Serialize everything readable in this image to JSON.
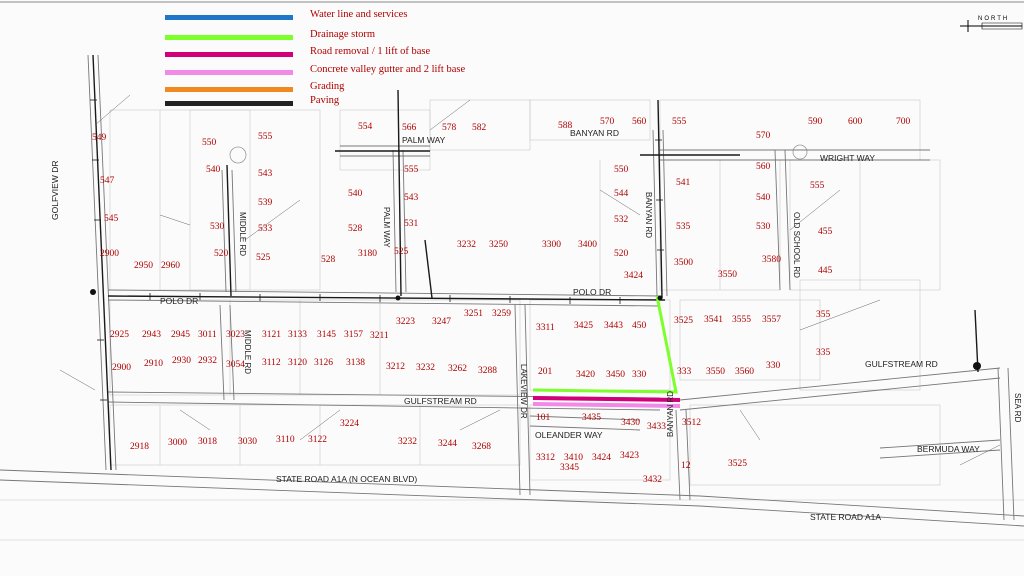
{
  "legend": [
    {
      "label": "Water line and services",
      "color": "#1f77c8"
    },
    {
      "label": "Drainage storm",
      "color": "#7cff2a"
    },
    {
      "label": "Road removal / 1 lift of base",
      "color": "#d1007a"
    },
    {
      "label": "Concrete valley gutter and 2 lift base",
      "color": "#f08ae6"
    },
    {
      "label": "Grading",
      "color": "#f08a1e"
    },
    {
      "label": "Paving",
      "color": "#222222"
    }
  ],
  "north_label": "NORTH",
  "streets": {
    "golfview": "GOLFVIEW DR",
    "palm_way_top": "PALM WAY",
    "palm_way_v": "PALM WAY",
    "middle_top": "MIDDLE RD",
    "middle_bottom": "MIDDLE RD",
    "banyan_top": "BANYAN RD",
    "banyan_v": "BANYAN RD",
    "banyan_bottom": "BANYAN RD",
    "wright": "WRIGHT WAY",
    "old_school": "OLD SCHOOL RD",
    "polo_left": "POLO DR",
    "polo_right": "POLO DR",
    "gulfstream_left": "GULFSTREAM RD",
    "gulfstream_right": "GULFSTREAM RD",
    "lakeview": "LAKEVIEW DR",
    "oleander": "OLEANDER WAY",
    "bermuda": "BERMUDA WAY",
    "sea": "SEA RD",
    "a1a_left": "STATE ROAD A1A (N OCEAN BLVD)",
    "a1a_right": "STATE ROAD A1A"
  },
  "lots": [
    "549",
    "547",
    "545",
    "550",
    "555",
    "540",
    "543",
    "539",
    "530",
    "533",
    "520",
    "525",
    "554",
    "566",
    "578",
    "582",
    "555",
    "540",
    "543",
    "528",
    "531",
    "525",
    "588",
    "570",
    "560",
    "555",
    "550",
    "544",
    "532",
    "520",
    "541",
    "535",
    "570",
    "590",
    "600",
    "700",
    "560",
    "555",
    "540",
    "530",
    "455",
    "445",
    "2900",
    "2950",
    "2960",
    "528",
    "3180",
    "3232",
    "3250",
    "3300",
    "3400",
    "3424",
    "3500",
    "3550",
    "3580",
    "2925",
    "2943",
    "2945",
    "3011",
    "3023",
    "3121",
    "3133",
    "3145",
    "3157",
    "3211",
    "3223",
    "3247",
    "3251",
    "3259",
    "3311",
    "3425",
    "3443",
    "450",
    "3525",
    "3541",
    "3555",
    "3557",
    "355",
    "335",
    "2900",
    "2910",
    "2930",
    "2932",
    "3054",
    "3112",
    "3120",
    "3126",
    "3138",
    "3212",
    "3232",
    "3262",
    "3288",
    "201",
    "3420",
    "3450",
    "330",
    "333",
    "3550",
    "3560",
    "330",
    "2918",
    "3000",
    "3018",
    "3030",
    "3110",
    "3122",
    "3224",
    "3232",
    "3244",
    "3268",
    "101",
    "3435",
    "3430",
    "3433",
    "3512",
    "3312",
    "3410",
    "3424",
    "3423",
    "3345",
    "12",
    "3432",
    "3525"
  ]
}
